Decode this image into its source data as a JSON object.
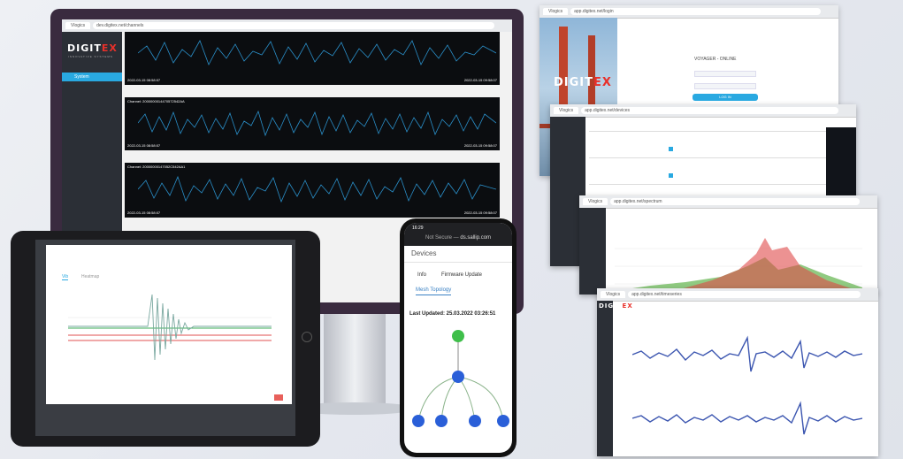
{
  "brand": {
    "name_left": "DIGIT",
    "name_x": "EX",
    "tagline": "INNOVATIVE SYSTEMS"
  },
  "monitor": {
    "sidebar_item": "System",
    "channels": [
      {
        "label": "",
        "start": "2022-03-15 08:58:07",
        "end": "2022-03-15 09:58:07"
      },
      {
        "label": "Channel: 2000000014470572542AA",
        "start": "2022-03-15 08:58:07",
        "end": "2022-03-15 09:58:07"
      },
      {
        "label": "Channel: 20000000147052C542AA1",
        "start": "2022-03-15 08:58:07",
        "end": "2022-03-15 09:58:07"
      }
    ]
  },
  "login": {
    "title": "VOYAGER - ONLINE",
    "button": "LOG IN"
  },
  "phone": {
    "time": "16:29",
    "url_prefix": "Not Secure — ",
    "url": "ds.sallip.com",
    "header": "Devices",
    "tabs": [
      "Info",
      "Firmware Update",
      "Mesh Topology"
    ],
    "updated": "Last Updated: 25.03.2022 03:26:51"
  },
  "tablet": {
    "tabs": [
      "Vib",
      "Heatmap"
    ]
  },
  "colors": {
    "monitor_body": "#3a2b3f",
    "sidebar": "#2b2f36",
    "accent": "#29a9e1",
    "mesh_root": "#3fbf4a",
    "mesh_node": "#2a5fd8"
  }
}
